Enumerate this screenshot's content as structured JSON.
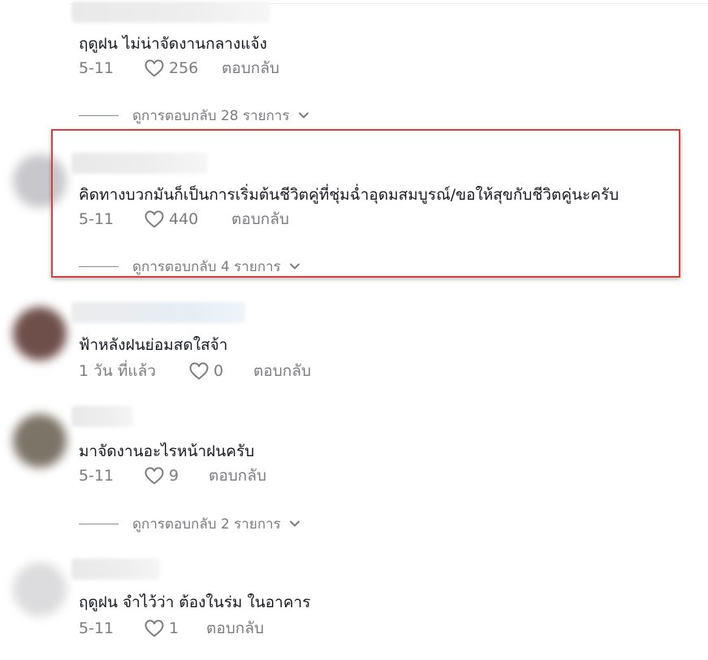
{
  "comments": [
    {
      "text": "ฤดูฝน ไม่น่าจัดงานกลางแจ้ง",
      "date": "5-11",
      "likes": "256",
      "reply_label": "ตอบกลับ",
      "view_replies": "ดูการตอบกลับ 28 รายการ"
    },
    {
      "text": "คิดทางบวกมันก็เป็นการเริ่มต้นชีวิตคู่ที่ชุ่มฉ่ำอุดมสมบูรณ์/ขอให้สุขกับชีวิตคู่นะครับ",
      "date": "5-11",
      "likes": "440",
      "reply_label": "ตอบกลับ",
      "view_replies": "ดูการตอบกลับ 4 รายการ"
    },
    {
      "text": "ฟ้าหลังฝนย่อมสดใสจ้า",
      "date": "1 วัน ที่แล้ว",
      "likes": "0",
      "reply_label": "ตอบกลับ"
    },
    {
      "text": "มาจัดงานอะไรหน้าฝนครับ",
      "date": "5-11",
      "likes": "9",
      "reply_label": "ตอบกลับ",
      "view_replies": "ดูการตอบกลับ 2 รายการ"
    },
    {
      "text": "ฤดูฝน จำไว้ว่า ต้องในร่ม ในอาคาร",
      "date": "5-11",
      "likes": "1",
      "reply_label": "ตอบกลับ"
    }
  ],
  "colors": {
    "highlight_border": "#d9403b",
    "text_primary": "#161823",
    "text_secondary": "#7a7c82"
  },
  "icons": {
    "like": "heart-outline-icon",
    "expand": "chevron-down-icon"
  }
}
